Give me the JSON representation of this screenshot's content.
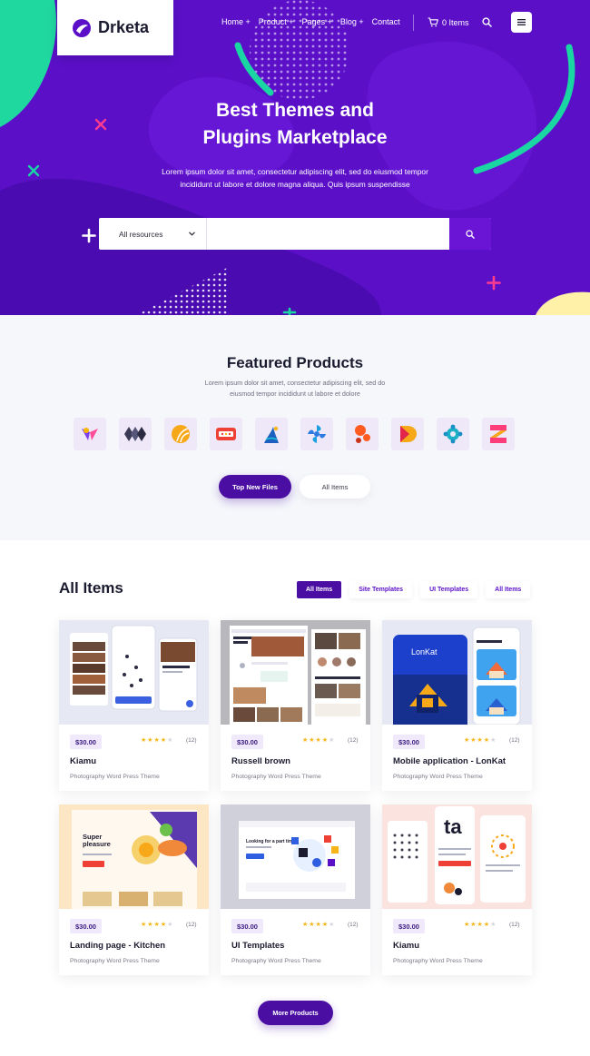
{
  "brand": {
    "name": "Drketa"
  },
  "nav": {
    "links": [
      "Home +",
      "Product +",
      "Pages +",
      "Blog +",
      "Contact"
    ],
    "cart_label": "0 Items"
  },
  "hero": {
    "title_line1": "Best Themes and",
    "title_line2": "Plugins Marketplace",
    "description": "Lorem ipsum dolor sit amet, consectetur adipiscing elit, sed do eiusmod tempor incididunt ut labore et dolore magna aliqua. Quis ipsum suspendisse",
    "search": {
      "select_value": "All resources",
      "input_value": "",
      "input_placeholder": ""
    }
  },
  "featured": {
    "title": "Featured Products",
    "description": "Lorem ipsum dolor sit amet, consectetur adipiscing elit, sed do eiusmod tempor incididunt ut labore et dolore",
    "buttons": {
      "primary": "Top New Files",
      "secondary": "All Items"
    }
  },
  "all_items": {
    "title": "All Items",
    "tabs": [
      "All Items",
      "Site Templates",
      "UI Templates",
      "All Items"
    ],
    "active_tab": 0,
    "cards": [
      {
        "price": "$30.00",
        "rating": 4,
        "reviews": "(12)",
        "name": "Kiamu",
        "category": "Photography Word Press Theme"
      },
      {
        "price": "$30.00",
        "rating": 4,
        "reviews": "(12)",
        "name": "Russell brown",
        "category": "Photography Word Press Theme"
      },
      {
        "price": "$30.00",
        "rating": 4,
        "reviews": "(12)",
        "name": "Mobile application - LonKat",
        "category": "Photography Word Press Theme"
      },
      {
        "price": "$30.00",
        "rating": 4,
        "reviews": "(12)",
        "name": "Landing page - Kitchen",
        "category": "Photography Word Press Theme"
      },
      {
        "price": "$30.00",
        "rating": 4,
        "reviews": "(12)",
        "name": "UI Templates",
        "category": "Photography Word Press Theme"
      },
      {
        "price": "$30.00",
        "rating": 4,
        "reviews": "(12)",
        "name": "Kiamu",
        "category": "Photography Word Press Theme"
      }
    ],
    "more_button": "More Products"
  },
  "thumb_texts": {
    "lonkat": "LonKat",
    "super": "Super",
    "pleasure": "pleasure",
    "looking": "Looking for a part time",
    "ta": "ta"
  },
  "colors": {
    "primary": "#5b10c8",
    "dark_primary": "#4a0ea3",
    "accent_teal": "#19d6a3",
    "accent_pink": "#ff3c8e",
    "star": "#f6b619"
  },
  "icons": [
    "brand-logo-icon",
    "cart-icon",
    "search-icon",
    "menu-icon",
    "chevron-down-icon"
  ]
}
